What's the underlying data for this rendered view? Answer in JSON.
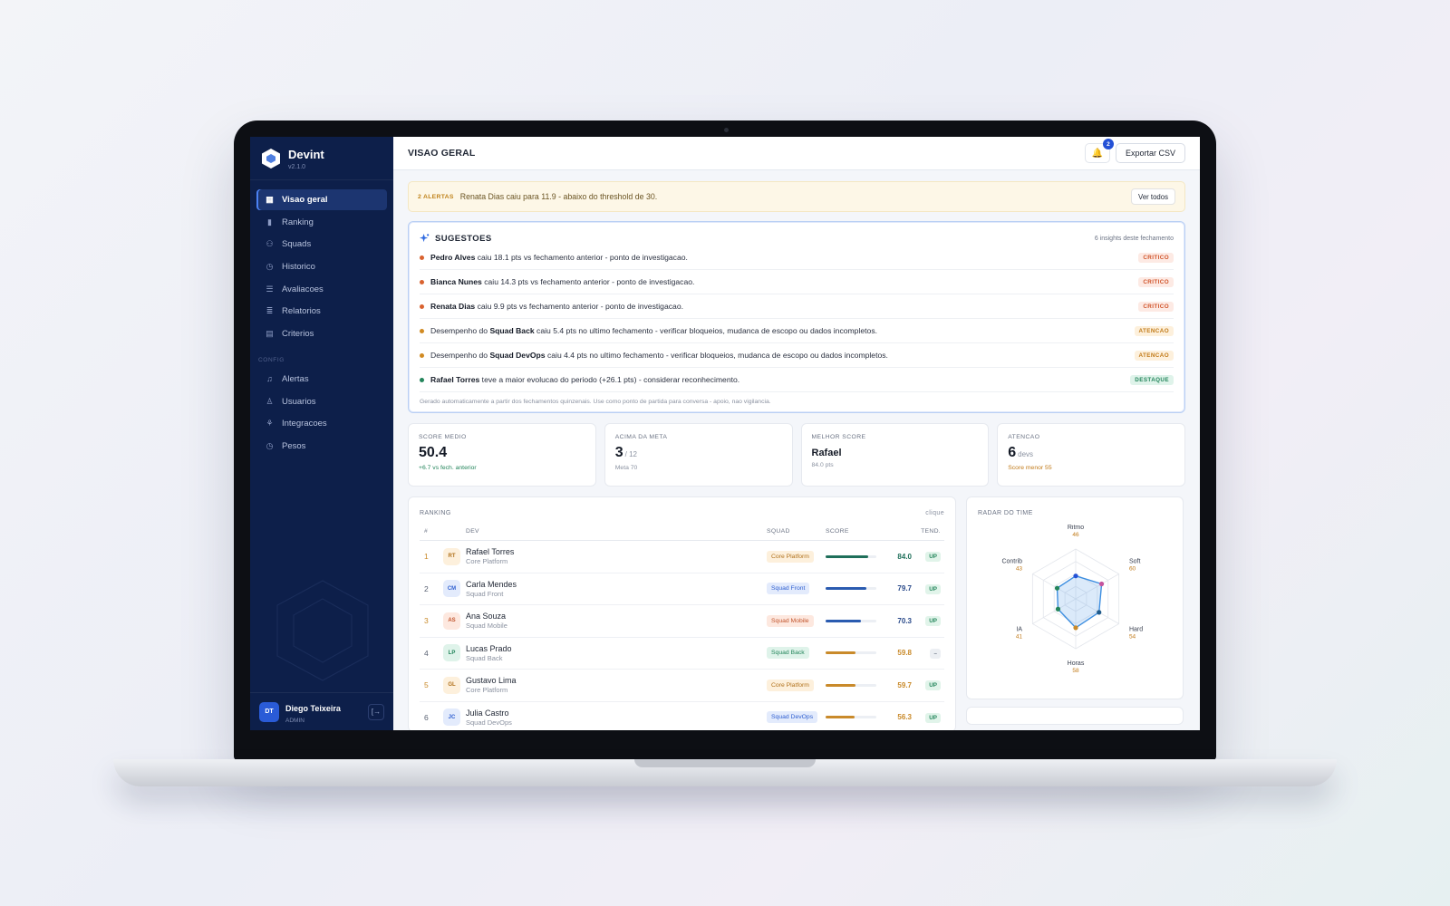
{
  "app": {
    "name": "Devint",
    "version": "v2.1.0"
  },
  "sidebar": {
    "items": [
      {
        "label": "Visao geral",
        "icon": "grid-icon",
        "active": true
      },
      {
        "label": "Ranking",
        "icon": "bar-chart-icon"
      },
      {
        "label": "Squads",
        "icon": "users-icon"
      },
      {
        "label": "Historico",
        "icon": "clock-icon"
      },
      {
        "label": "Avaliacoes",
        "icon": "list-icon"
      },
      {
        "label": "Relatorios",
        "icon": "report-icon"
      },
      {
        "label": "Criterios",
        "icon": "document-icon"
      }
    ],
    "config_section": "CONFIG",
    "config_items": [
      {
        "label": "Alertas",
        "icon": "bell-icon"
      },
      {
        "label": "Usuarios",
        "icon": "user-icon"
      },
      {
        "label": "Integracoes",
        "icon": "integration-icon"
      },
      {
        "label": "Pesos",
        "icon": "clock-icon"
      }
    ],
    "user": {
      "initials": "DT",
      "name": "Diego Teixeira",
      "role": "ADMIN"
    }
  },
  "header": {
    "title": "VISAO GERAL",
    "notifications": "2",
    "export_label": "Exportar CSV"
  },
  "alert": {
    "tag": "2 ALERTAS",
    "text": "Renata Dias caiu para 11.9 - abaixo do threshold de 30.",
    "button": "Ver todos"
  },
  "suggestions": {
    "title": "SUGESTOES",
    "count": "6 insights deste fechamento",
    "items": [
      {
        "pre": "",
        "bold": "Pedro Alves",
        "post": " caiu 18.1 pts vs fechamento anterior - ponto de investigacao.",
        "badge": "CRITICO",
        "level": "crit"
      },
      {
        "pre": "",
        "bold": "Bianca Nunes",
        "post": " caiu 14.3 pts vs fechamento anterior - ponto de investigacao.",
        "badge": "CRITICO",
        "level": "crit"
      },
      {
        "pre": "",
        "bold": "Renata Dias",
        "post": " caiu 9.9 pts vs fechamento anterior - ponto de investigacao.",
        "badge": "CRITICO",
        "level": "crit"
      },
      {
        "pre": "Desempenho do ",
        "bold": "Squad Back",
        "post": " caiu 5.4 pts no ultimo fechamento - verificar bloqueios, mudanca de escopo ou dados incompletos.",
        "badge": "ATENCAO",
        "level": "warn"
      },
      {
        "pre": "Desempenho do ",
        "bold": "Squad DevOps",
        "post": " caiu 4.4 pts no ultimo fechamento - verificar bloqueios, mudanca de escopo ou dados incompletos.",
        "badge": "ATENCAO",
        "level": "warn"
      },
      {
        "pre": "",
        "bold": "Rafael Torres",
        "post": " teve a maior evolucao do periodo (+26.1 pts) - considerar reconhecimento.",
        "badge": "DESTAQUE",
        "level": "star"
      }
    ],
    "footer": "Gerado automaticamente a partir dos fechamentos quinzenais. Use como ponto de partida para conversa - apoio, nao vigilancia."
  },
  "kpis": [
    {
      "label": "SCORE MEDIO",
      "value": "50.4",
      "unit": "",
      "sub": "+6.7 vs fech. anterior",
      "sub_color": "#23855b"
    },
    {
      "label": "ACIMA DA META",
      "value": "3",
      "unit": "/ 12",
      "sub": "Meta 70",
      "sub_color": "#8a91a0"
    },
    {
      "label": "MELHOR SCORE",
      "value": "Rafael",
      "unit": "",
      "sub": "84.0 pts",
      "sub_color": "#8a91a0"
    },
    {
      "label": "ATENCAO",
      "value": "6",
      "unit": "devs",
      "sub": "Score menor 55",
      "sub_color": "#c17a18"
    }
  ],
  "ranking": {
    "title": "RANKING",
    "hint": "clique",
    "columns": {
      "rank": "#",
      "dev": "DEV",
      "squad": "SQUAD",
      "score": "SCORE",
      "trend": "TEND."
    },
    "rows": [
      {
        "rank": "1",
        "initials": "RT",
        "name": "Rafael Torres",
        "squad": "Core Platform",
        "score": "84.0",
        "value": 84.0,
        "trend": "UP"
      },
      {
        "rank": "2",
        "initials": "CM",
        "name": "Carla Mendes",
        "squad": "Squad Front",
        "score": "79.7",
        "value": 79.7,
        "trend": "UP"
      },
      {
        "rank": "3",
        "initials": "AS",
        "name": "Ana Souza",
        "squad": "Squad Mobile",
        "score": "70.3",
        "value": 70.3,
        "trend": "UP"
      },
      {
        "rank": "4",
        "initials": "LP",
        "name": "Lucas Prado",
        "squad": "Squad Back",
        "score": "59.8",
        "value": 59.8,
        "trend": "–"
      },
      {
        "rank": "5",
        "initials": "GL",
        "name": "Gustavo Lima",
        "squad": "Core Platform",
        "score": "59.7",
        "value": 59.7,
        "trend": "UP"
      },
      {
        "rank": "6",
        "initials": "JC",
        "name": "Julia Castro",
        "squad": "Squad DevOps",
        "score": "56.3",
        "value": 56.3,
        "trend": "UP"
      }
    ]
  },
  "radar": {
    "title": "RADAR DO TIME",
    "axes": [
      {
        "label": "Ritmo",
        "value": 46
      },
      {
        "label": "Soft",
        "value": 60
      },
      {
        "label": "Hard",
        "value": 54
      },
      {
        "label": "Horas",
        "value": 58
      },
      {
        "label": "IA",
        "value": 41
      },
      {
        "label": "Contrib",
        "value": 43
      }
    ],
    "max": 100
  },
  "colors": {
    "crit": "#d9622f",
    "warn": "#d18a22",
    "star": "#23855b",
    "accent": "#2451d6",
    "sidebar": "#0d1f4a"
  }
}
